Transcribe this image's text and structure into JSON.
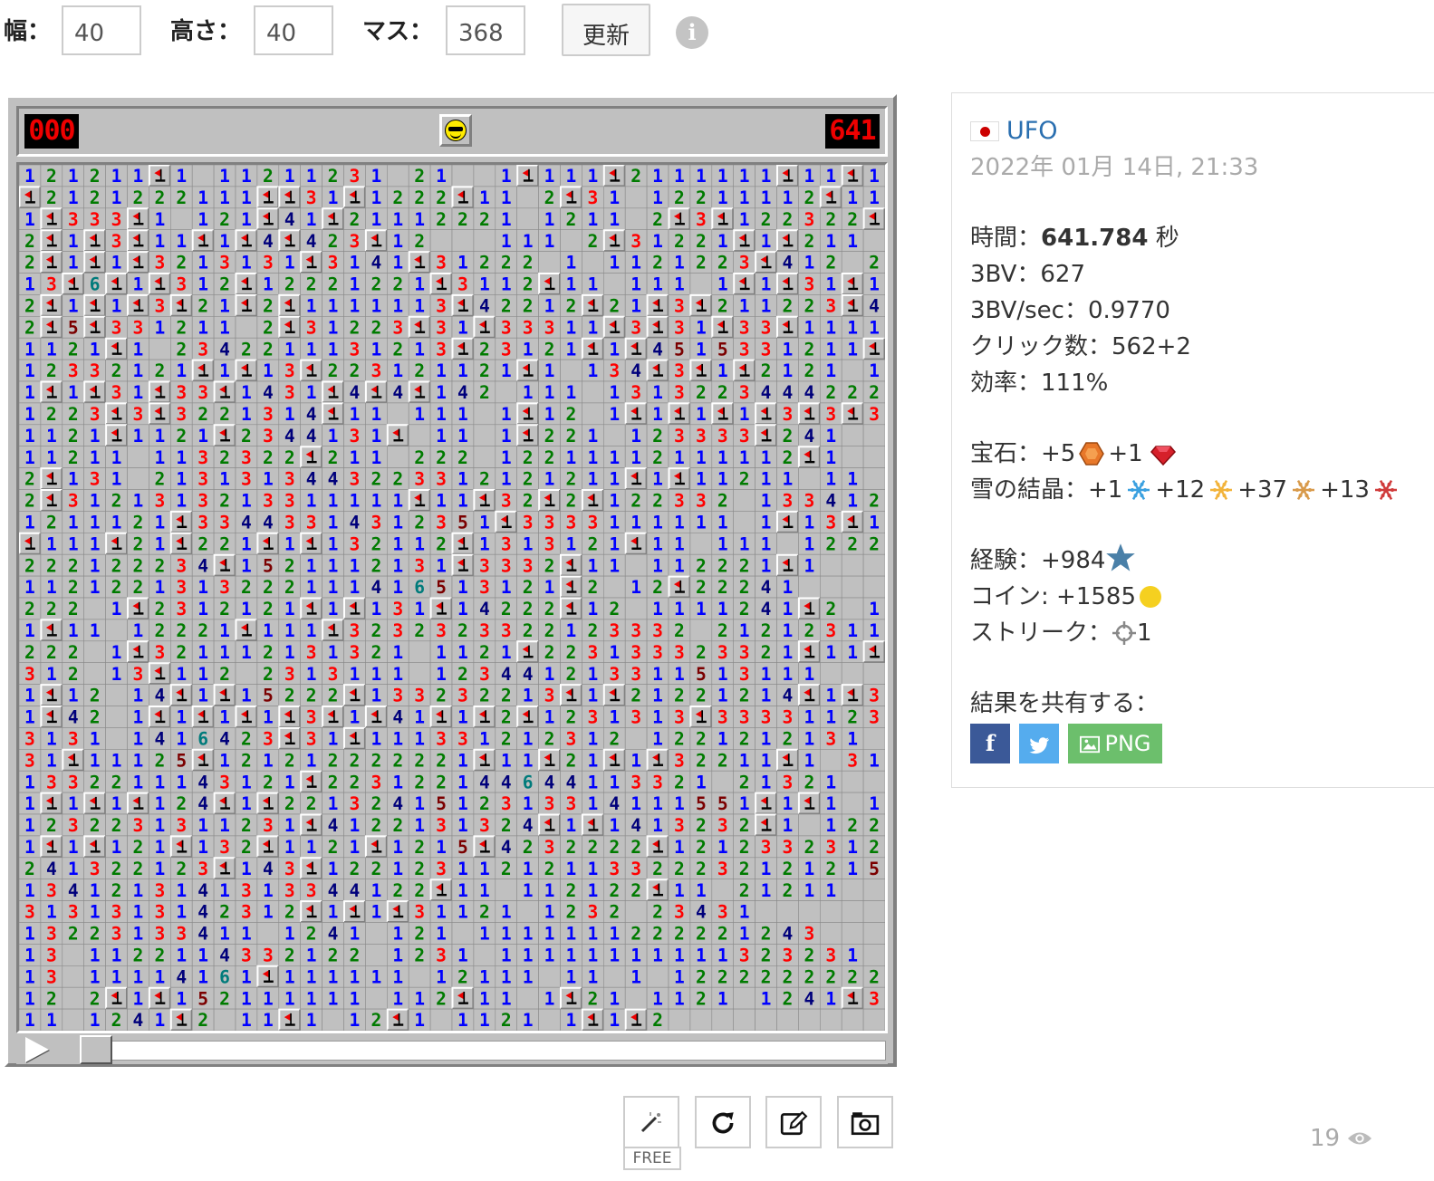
{
  "toolbar": {
    "width_label": "幅：",
    "width_value": "40",
    "height_label": "高さ：",
    "height_value": "40",
    "mines_label": "マス：",
    "mines_value": "368",
    "refresh_label": "更新",
    "info_icon": "info-icon"
  },
  "game": {
    "mine_counter": "000",
    "timer": "641",
    "face": "sunglasses-face",
    "rows": 40,
    "cols": 40,
    "board": [
      "121211F1 11211231 21  1F111F2111111F11F1",
      "F2121222111FF31F1222F11 2F31 12211112F111F111222",
      "1F333F1 121F41F21112221 1211 2F3F122322F1111122F1",
      "2F1F3F11F1F4F423F12   111 2F31221F1F211  1F1F2",
      "2F1F1F3213131F3141F31222 1 1121223F412 2412",
      "13F6F1F312F12221221F3112F11 111 1F1F31F11F132",
      "2F1F1F3F21F2F1111113F42212F21F3F211223F43312222F1",
      "2F5F331211 2F31223F31F33311F3F31F33F1111",
      "1121F1 2342211131213F23121F1F4515331211F22",
      "12332121F1F13F223121121F1 134F3F1F2121 1F1F1",
      "1F1F31F33F1431F4F4F142 111 1313223444222243",
      "1223F3F3221314F11 111 1F12 1F1F1F1F3F3F3F1",
      "1121F1121F2344131F 11 1F221 123333F241",
      "11211 1132322F211 222 12211112111112F1",
      "2F131 2131313443223312121211F1F11211 11",
      "2F3121313213311111F11F32F2F122332 133412",
      "1211121F33443314312351F3333111111 1F13F131",
      "F111F21F221F1F132112F1313121F11 111 122222F1332",
      "222122234F1521112131F3332F11 112221F1",
      "1121221313222111416513121F2 12F22241",
      "222 1F2312121F1F131F14222F12 1111241F2 11",
      "1F11 12221F111F3232323322123332 212123112 11",
      "222 1F321112131321 1121F223133323321F11F1",
      "312 13F112 2313111 123441213311513111",
      "1F12 14F1F15222F133232213F1F21221214F1F3F11",
      "1F42 1F1F1F1F3F1F41F1F2F1231313F333311231F1322321",
      "3131 1416423F31F111331212312 1221212131",
      "31F11125F121212222221F11F21F1F32211F1 3131",
      "1332211143121F223122144644113321 21321",
      "1F1F1F124F1F2213241512313314111551F1F1 11121",
      "1232231311231F4122131324F1F1413232F1 12231",
      "1F1F121F132F1121F1215F4232222F121233231211121F1",
      "241322123F143F1221231121211332223212121531",
      "1341213141313344122F11 112122F11 21211",
      "3131313142312F1F1F31121 1232 23431",
      "13223133411 1241 121 1111111222221243",
      "13 1122114332122 1231 11111111111323231",
      "13 11114161F111111 12111 11 1 12222222224F1",
      "12 2F1F152111111 112F11 1F21 1121 1241F3F1",
      "11 1241F2 11F1 12F1 1121 1F1F2"
    ]
  },
  "replay": {
    "play_icon": "play-icon"
  },
  "result": {
    "country_flag": "japan-flag-icon",
    "user": "UFO",
    "date": "2022年 01月 14日, 21:33",
    "time_label": "時間：",
    "time_value": "641.784",
    "time_unit": " 秒",
    "bv_label": "3BV：",
    "bv_value": "627",
    "bvs_label": "3BV/sec：",
    "bvs_value": "0.9770",
    "clicks_label": "クリック数：",
    "clicks_value": "562+2",
    "efficiency_label": "効率：",
    "efficiency_value": "111%",
    "gems_label": "宝石：",
    "gem1_value": "+5",
    "gem1_icon": "amber-gem-icon",
    "gem1_color": "#e8782a",
    "gem2_value": "+1",
    "gem2_icon": "ruby-gem-icon",
    "gem2_color": "#d6202a",
    "snow_label": "雪の結晶：",
    "snow1_value": "+1",
    "snow1_color": "#3aa0e0",
    "snow2_value": "+12",
    "snow2_color": "#f2b33a",
    "snow3_value": "+37",
    "snow3_color": "#d89a4a",
    "snow4_value": "+13",
    "snow4_color": "#d03a3a",
    "exp_label": "経験：",
    "exp_value": "+984",
    "coin_label": "コイン: ",
    "coin_value": "+1585",
    "streak_label": "ストリーク：",
    "streak_value": "1",
    "share_label": "結果を共有する：",
    "facebook_label": "f",
    "png_label": "PNG"
  },
  "tools": {
    "free_label": "FREE",
    "views": "19"
  }
}
